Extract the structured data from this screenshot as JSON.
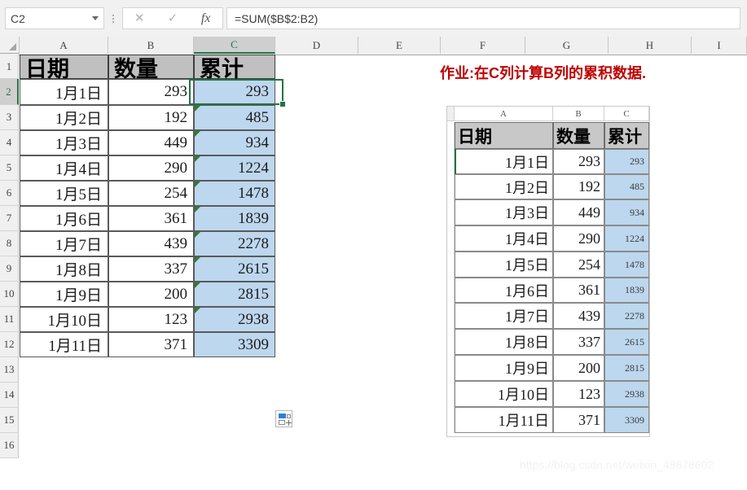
{
  "formula_bar": {
    "name_box_value": "C2",
    "name_box_caret_icon": "chevron-down-icon",
    "cancel_icon": "✕",
    "confirm_icon": "✓",
    "function_icon": "fx",
    "formula_value": "=SUM($B$2:B2)"
  },
  "grid": {
    "column_headers": [
      "A",
      "B",
      "C",
      "D",
      "E",
      "F",
      "G",
      "H",
      "I"
    ],
    "selected_column": "C",
    "row_headers": [
      "1",
      "2",
      "3",
      "4",
      "5",
      "6",
      "7",
      "8",
      "9",
      "10",
      "11",
      "12",
      "13",
      "14",
      "15",
      "16"
    ],
    "selected_row": "2",
    "selected_cell": "C2",
    "table_headers": [
      "日期",
      "数量",
      "累计"
    ],
    "rows": [
      {
        "date": "1月1日",
        "qty": "293",
        "cum": "293",
        "has_error_flag": false
      },
      {
        "date": "1月2日",
        "qty": "192",
        "cum": "485",
        "has_error_flag": true
      },
      {
        "date": "1月3日",
        "qty": "449",
        "cum": "934",
        "has_error_flag": true
      },
      {
        "date": "1月4日",
        "qty": "290",
        "cum": "1224",
        "has_error_flag": true
      },
      {
        "date": "1月5日",
        "qty": "254",
        "cum": "1478",
        "has_error_flag": true
      },
      {
        "date": "1月6日",
        "qty": "361",
        "cum": "1839",
        "has_error_flag": true
      },
      {
        "date": "1月7日",
        "qty": "439",
        "cum": "2278",
        "has_error_flag": true
      },
      {
        "date": "1月8日",
        "qty": "337",
        "cum": "2615",
        "has_error_flag": true
      },
      {
        "date": "1月9日",
        "qty": "200",
        "cum": "2815",
        "has_error_flag": true
      },
      {
        "date": "1月10日",
        "qty": "123",
        "cum": "2938",
        "has_error_flag": true
      },
      {
        "date": "1月11日",
        "qty": "371",
        "cum": "3309",
        "has_error_flag": false
      }
    ],
    "autofill_options_icon": "autofill-options-icon",
    "fill_handle_icon": "fill-handle"
  },
  "annotation": {
    "title": "作业:在C列计算B列的累积数据.",
    "title_color": "#C00000"
  },
  "inset": {
    "column_headers": [
      "A",
      "B",
      "C"
    ],
    "table_headers": [
      "日期",
      "数量",
      "累计"
    ],
    "rows": [
      {
        "date": "1月1日",
        "qty": "293",
        "cum": "293"
      },
      {
        "date": "1月2日",
        "qty": "192",
        "cum": "485"
      },
      {
        "date": "1月3日",
        "qty": "449",
        "cum": "934"
      },
      {
        "date": "1月4日",
        "qty": "290",
        "cum": "1224"
      },
      {
        "date": "1月5日",
        "qty": "254",
        "cum": "1478"
      },
      {
        "date": "1月6日",
        "qty": "361",
        "cum": "1839"
      },
      {
        "date": "1月7日",
        "qty": "439",
        "cum": "2278"
      },
      {
        "date": "1月8日",
        "qty": "337",
        "cum": "2615"
      },
      {
        "date": "1月9日",
        "qty": "200",
        "cum": "2815"
      },
      {
        "date": "1月10日",
        "qty": "123",
        "cum": "2938"
      },
      {
        "date": "1月11日",
        "qty": "371",
        "cum": "3309"
      }
    ]
  },
  "watermark": {
    "text": "https://blog.csdn.net/weixin_48678602"
  },
  "colors": {
    "selection_green": "#217346",
    "cum_fill_blue": "#BDD7EE",
    "header_gray": "#C0C0C0"
  }
}
